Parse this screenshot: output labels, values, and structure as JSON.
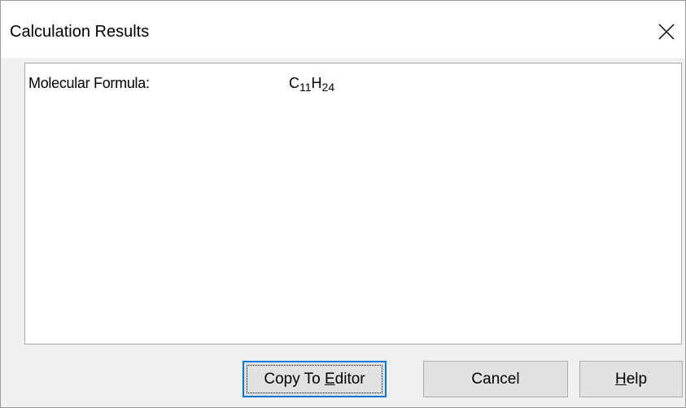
{
  "window": {
    "title": "Calculation Results",
    "close_icon": "close-icon"
  },
  "results": [
    {
      "label": "Molecular Formula:",
      "formula": [
        {
          "element": "C",
          "count": "11"
        },
        {
          "element": "H",
          "count": "24"
        }
      ]
    }
  ],
  "buttons": {
    "copy": {
      "before": "Copy To ",
      "accel": "E",
      "after": "ditor"
    },
    "cancel": {
      "label": "Cancel"
    },
    "help": {
      "before": "",
      "accel": "H",
      "after": "elp"
    }
  },
  "colors": {
    "dialog_bg": "#f0f0f0",
    "default_button_border": "#0078d7",
    "button_bg": "#e1e1e1"
  }
}
